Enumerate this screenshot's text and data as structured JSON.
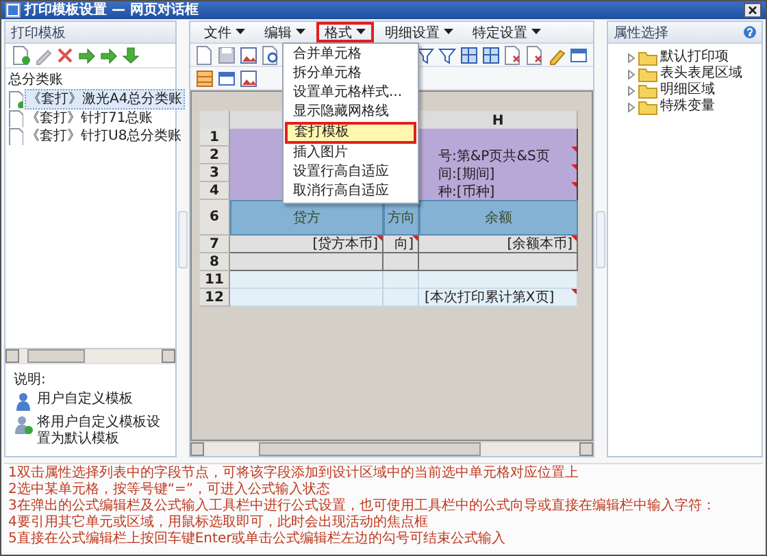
{
  "window": {
    "title": "打印模板设置 — 网页对话框"
  },
  "left_panel": {
    "title": "打印模板",
    "tree": {
      "label": "总分类账",
      "children": [
        {
          "label": "《套打》激光A4总分类账",
          "selected": true,
          "kind": "default"
        },
        {
          "label": "《套打》针打71总账",
          "selected": false,
          "kind": "template"
        },
        {
          "label": "《套打》针打U8总分类账",
          "selected": false,
          "kind": "template"
        }
      ]
    },
    "legend": {
      "title": "说明:",
      "items": [
        {
          "kind": "user",
          "label": "用户自定义模板"
        },
        {
          "kind": "default",
          "label": "将用户自定义模板设置为默认模板"
        }
      ]
    }
  },
  "menubar": [
    {
      "label": "文件",
      "selected": false
    },
    {
      "label": "编辑",
      "selected": false
    },
    {
      "label": "格式",
      "selected": true
    },
    {
      "label": "明细设置",
      "selected": false
    },
    {
      "label": "特定设置",
      "selected": false
    }
  ],
  "dropdown": [
    {
      "label": "合并单元格",
      "selected": false
    },
    {
      "label": "拆分单元格",
      "selected": false
    },
    {
      "label": "设置单元格样式...",
      "selected": false
    },
    {
      "label": "显示隐藏网格线",
      "selected": false
    },
    {
      "label": "套打模板",
      "selected": true
    },
    {
      "label": "插入图片",
      "selected": false
    },
    {
      "label": "设置行高自适应",
      "selected": false
    },
    {
      "label": "取消行高自适应",
      "selected": false
    }
  ],
  "sheet": {
    "column_header": "H",
    "rows": [
      {
        "number": "1",
        "kind": "band"
      },
      {
        "number": "2",
        "kind": "band",
        "column_h": {
          "text": "号:第&P页共&S页",
          "marked": true
        }
      },
      {
        "number": "3",
        "kind": "band",
        "column_h": {
          "text": "间:[期间]",
          "marked": true
        }
      },
      {
        "number": "4",
        "kind": "band",
        "column_h": {
          "text": "种:[币种]",
          "marked": true
        }
      },
      {
        "number": "6",
        "kind": "heading",
        "column_1": {
          "text": "贷方"
        },
        "column_2": {
          "text": "方向"
        },
        "column_h": {
          "text": "余额"
        }
      },
      {
        "number": "7",
        "kind": "field",
        "column_1": {
          "text": "[贷方本币]",
          "marked": true
        },
        "column_2": {
          "text": "向]",
          "marked": true
        },
        "column_h": {
          "text": "[余额本币]",
          "marked": true
        }
      },
      {
        "number": "8",
        "kind": "field"
      },
      {
        "number": "11",
        "kind": "footer"
      },
      {
        "number": "12",
        "kind": "footer",
        "column_h": {
          "text": "[本次打印累计第X页]",
          "marked": true
        }
      }
    ]
  },
  "property_panel": {
    "title": "属性选择",
    "items": [
      {
        "label": "默认打印项",
        "expanded": false
      },
      {
        "label": "表头表尾区域",
        "expanded": false
      },
      {
        "label": "明细区域",
        "expanded": false
      },
      {
        "label": "特殊变量",
        "expanded": false
      }
    ]
  },
  "notes": [
    "1双击属性选择列表中的字段节点，可将该字段添加到设计区域中的当前选中单元格对应位置上",
    "2选中某单元格，按等号键“=”，可进入公式输入状态",
    "3在弹出的公式编辑栏及公式输入工具栏中进行公式设置，也可使用工具栏中的公式向导或直接在编辑栏中输入字符：",
    "4要引用其它单元或区域，用鼠标选取即可，此时会出现活动的焦点框",
    "5直接在公式编辑栏上按回车键Enter或单击公式编辑栏左边的勾号可结束公式输入"
  ]
}
